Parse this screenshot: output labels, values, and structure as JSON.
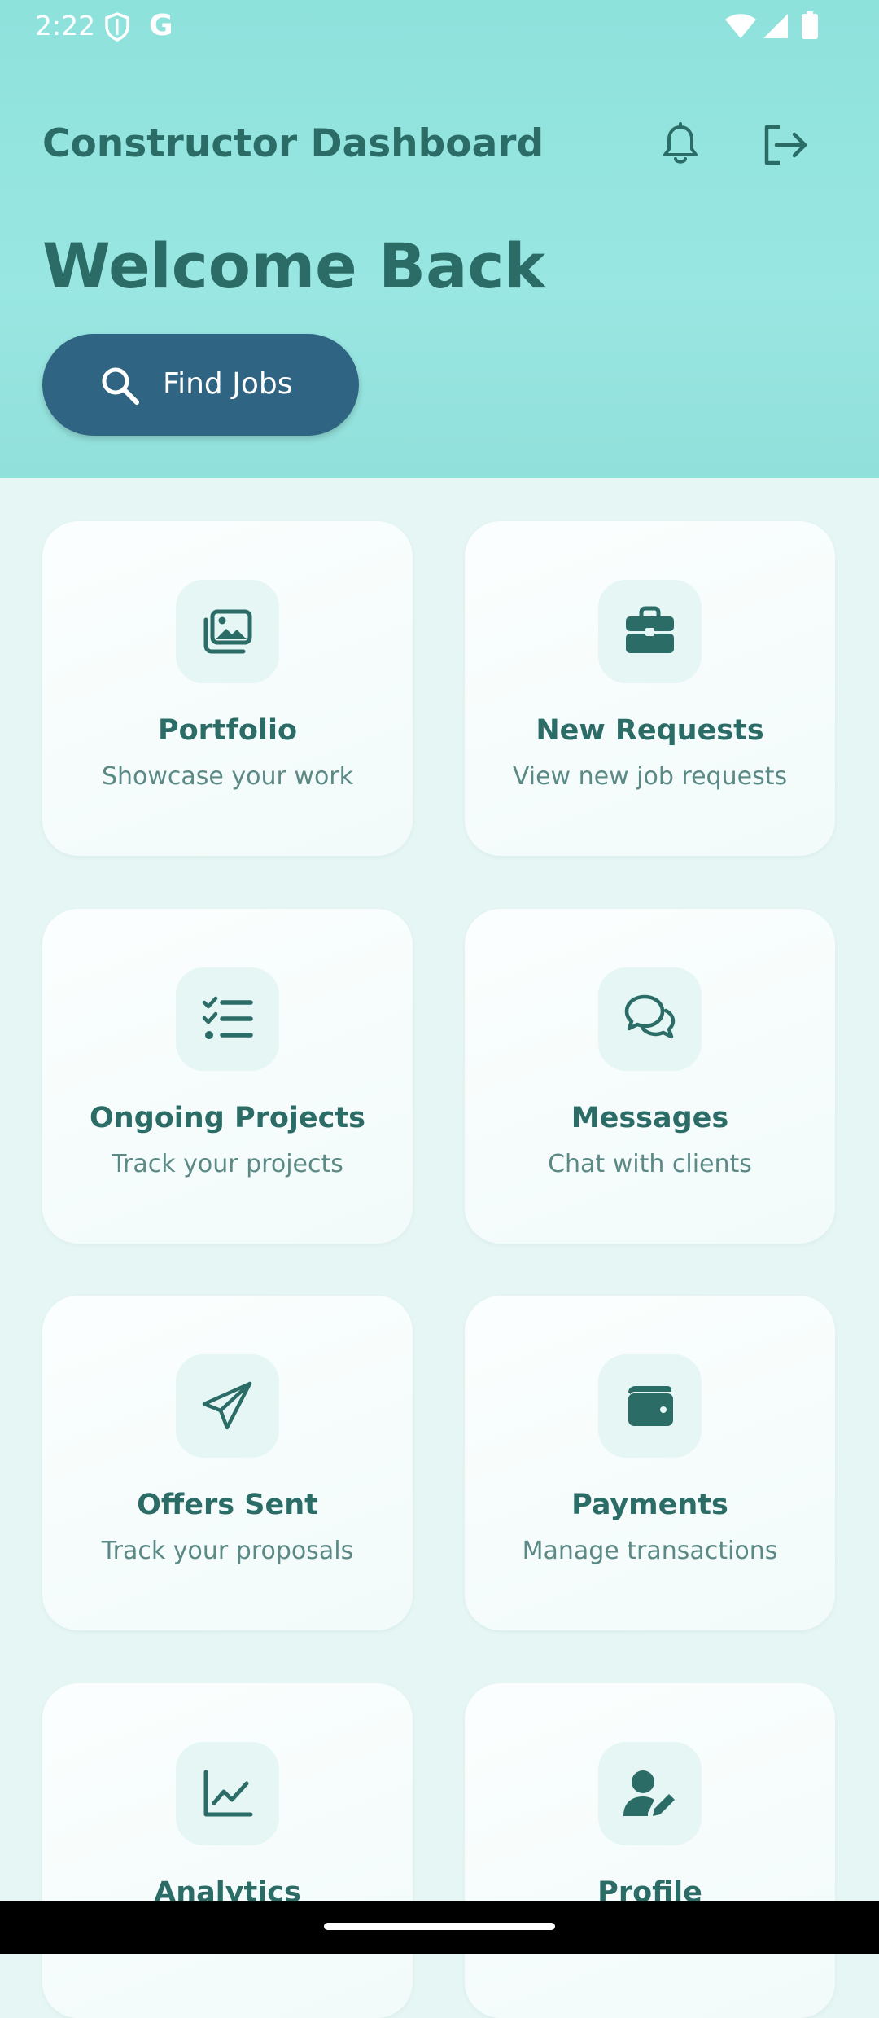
{
  "status_bar": {
    "time": "2:22",
    "g_glyph": "G",
    "icons": [
      "shield-icon",
      "g-icon",
      "wifi-icon",
      "signal-icon",
      "battery-icon"
    ]
  },
  "header": {
    "title": "Constructor Dashboard",
    "welcome": "Welcome Back",
    "find_jobs_label": "Find Jobs",
    "icons": [
      "bell-icon",
      "logout-icon",
      "search-icon"
    ]
  },
  "colors": {
    "header_bg": "#92e0db",
    "page_bg": "#e6f6f4",
    "primary_text": "#2c6c67",
    "secondary_text": "#5b8985",
    "button_bg": "#2f6583",
    "icon_box_bg": "#e5f6f4"
  },
  "cards": [
    {
      "title": "Portfolio",
      "subtitle": "Showcase your work",
      "icon": "portfolio-icon"
    },
    {
      "title": "New Requests",
      "subtitle": "View new job requests",
      "icon": "briefcase-icon"
    },
    {
      "title": "Ongoing Projects",
      "subtitle": "Track your projects",
      "icon": "checklist-icon"
    },
    {
      "title": "Messages",
      "subtitle": "Chat with clients",
      "icon": "chat-icon"
    },
    {
      "title": "Offers Sent",
      "subtitle": "Track your proposals",
      "icon": "paper-plane-icon"
    },
    {
      "title": "Payments",
      "subtitle": "Manage transactions",
      "icon": "wallet-icon"
    },
    {
      "title": "Analytics",
      "subtitle": "",
      "icon": "chart-line-icon"
    },
    {
      "title": "Profile",
      "subtitle": "",
      "icon": "user-edit-icon"
    }
  ]
}
